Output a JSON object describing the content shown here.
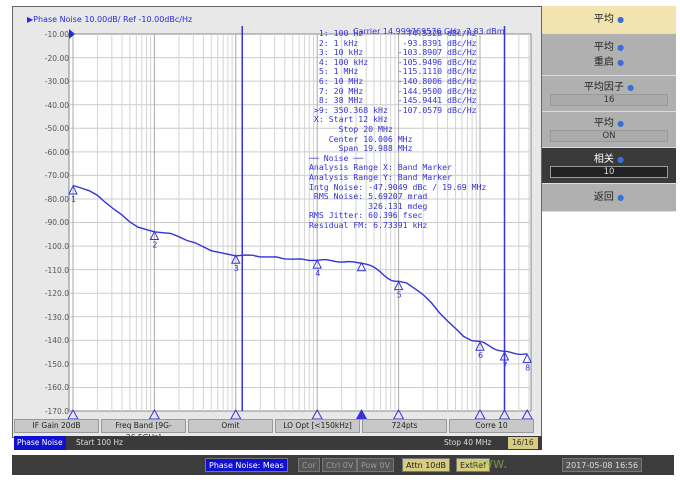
{
  "trace_title": "▶Phase Noise 10.00dB/ Ref -10.00dBc/Hz",
  "carrier": "Carrier 14.999769576 GHz    -7.83 dBm",
  "y_labels": [
    "-10.00",
    "-20.00",
    "-30.00",
    "-40.00",
    "-50.00",
    "-60.00",
    "-70.00",
    "-80.00",
    "-90.00",
    "-100.0",
    "-110.0",
    "-120.0",
    "-130.0",
    "-140.0",
    "-150.0",
    "-160.0",
    "-170.0"
  ],
  "markers": [
    {
      "id": "1",
      "freq": "100 Hz",
      "value": "-74.5328",
      "unit": "dBc/Hz"
    },
    {
      "id": "2",
      "freq": "1 kHz",
      "value": "-93.8391",
      "unit": "dBc/Hz"
    },
    {
      "id": "3",
      "freq": "10 kHz",
      "value": "-103.8907",
      "unit": "dBc/Hz"
    },
    {
      "id": "4",
      "freq": "100 kHz",
      "value": "-105.9496",
      "unit": "dBc/Hz"
    },
    {
      "id": "5",
      "freq": "1 MHz",
      "value": "-115.1110",
      "unit": "dBc/Hz"
    },
    {
      "id": "6",
      "freq": "10 MHz",
      "value": "-140.8006",
      "unit": "dBc/Hz"
    },
    {
      "id": "7",
      "freq": "20 MHz",
      "value": "-144.9500",
      "unit": "dBc/Hz"
    },
    {
      "id": "8",
      "freq": "38 MHz",
      "value": "-145.9441",
      "unit": "dBc/Hz"
    },
    {
      "id": ">9",
      "freq": "350.368 kHz",
      "value": "-107.0579",
      "unit": "dBc/Hz"
    }
  ],
  "band": {
    "start": "X: Start 12 kHz",
    "stop": "Stop 20 MHz",
    "center": "Center 10.006 MHz",
    "span": "Span 19.988 MHz"
  },
  "noise": {
    "header": "── Noise ──",
    "range_x": "Analysis Range X: Band Marker",
    "range_y": "Analysis Range Y: Band Marker",
    "intg": "Intg Noise: -47.9049 dBc / 19.69 MHz",
    "rms": "RMS Noise: 5.69207 mrad",
    "rms_deg": "326.131 mdeg",
    "jitter": "RMS Jitter: 60.396 fsec",
    "residual_fm": "Residual FM: 6.73391 kHz"
  },
  "chart_data": {
    "type": "line",
    "x_scale": "log",
    "xlim": [
      100,
      40000000
    ],
    "ylim": [
      -170,
      -10
    ],
    "grid": true,
    "x": [
      100,
      1000,
      10000,
      100000,
      350368,
      1000000,
      10000000,
      20000000,
      38000000
    ],
    "y": [
      -74.5328,
      -93.8391,
      -103.8907,
      -105.9496,
      -107.0579,
      -115.111,
      -140.8006,
      -144.95,
      -145.9441
    ],
    "band_markers_hz": [
      12000,
      20000000
    ],
    "color": "#3434d8"
  },
  "status_row": [
    "IF Gain 20dB",
    "Freq Band [9G-26.5GHz]",
    "Omit",
    "LO Opt [<150kHz]",
    "724pts",
    "Corre 10"
  ],
  "bar2": {
    "mode": "Phase Noise",
    "start": "Start 100 Hz",
    "stop": "Stop 40 MHz",
    "count": "16/16"
  },
  "bar3": [
    "Phase Noise: Meas",
    "Cor",
    "Ctrl 0V",
    "Pow 0V",
    "Attn 10dB",
    "ExtRef",
    "2017-05-08 16:56"
  ],
  "softkeys": {
    "title": "平均",
    "avg_restart_1": "平均",
    "avg_restart_2": "重启",
    "avg_factor": "平均因子",
    "avg_factor_value": "16",
    "avg": "平均",
    "avg_value": "ON",
    "corr": "相关",
    "corr_value": "10",
    "back": "返回"
  },
  "watermark": "www."
}
